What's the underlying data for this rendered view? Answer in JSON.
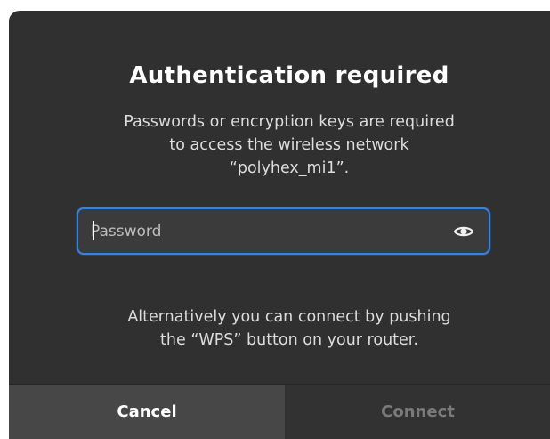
{
  "dialog": {
    "title": "Authentication required",
    "message_lines": [
      "Passwords or encryption keys are required",
      "to access the wireless network",
      "“polyhex_mi1”."
    ],
    "password": {
      "value": "",
      "placeholder": "Password",
      "reveal_icon": "eye-icon"
    },
    "alternative_lines": [
      "Alternatively you can connect by pushing",
      "the “WPS” button on your router."
    ],
    "buttons": {
      "cancel": "Cancel",
      "connect": "Connect"
    },
    "colors": {
      "background": "#303030",
      "accent": "#3584e4",
      "cancel_bg": "#474747",
      "connect_text_disabled": "#7a7a7a"
    }
  }
}
